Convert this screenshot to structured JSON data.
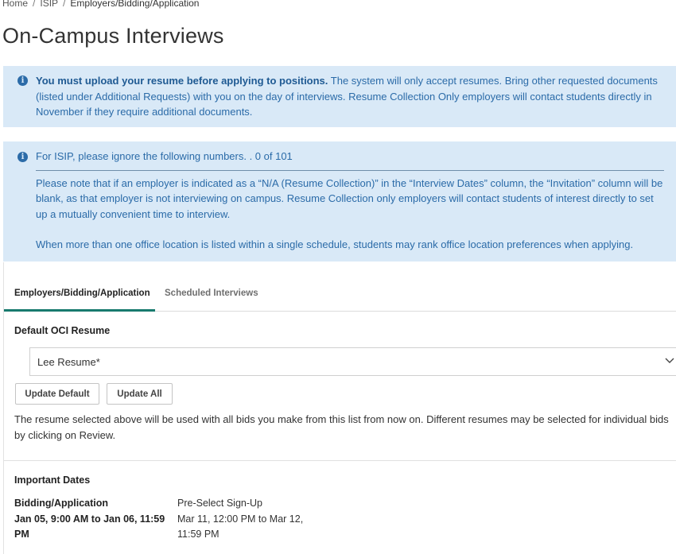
{
  "breadcrumb": {
    "items": [
      "Home",
      "ISIP"
    ],
    "current": "Employers/Bidding/Application",
    "separator": "/"
  },
  "page_title": "On-Campus Interviews",
  "alert1": {
    "bold": "You must upload your resume before applying to positions.",
    "text": " The system will only accept resumes. Bring other requested documents (listed under Additional Requests) with you on the day of interviews. Resume Collection Only employers will contact students directly in November if they require additional documents."
  },
  "alert2": {
    "header": "For ISIP, please ignore the following numbers. . 0 of 101",
    "para1": "Please note that if an employer is indicated as a “N/A (Resume Collection)” in the “Interview Dates” column, the “Invitation” column will be blank, as that employer is not interviewing on campus. Resume Collection only employers will contact students of interest directly to set up a mutually convenient time to interview.",
    "para2": "When more than one office location is listed within a single schedule, students may rank office location preferences when applying."
  },
  "tabs": [
    {
      "label": "Employers/Bidding/Application",
      "active": true
    },
    {
      "label": "Scheduled Interviews",
      "active": false
    }
  ],
  "resume": {
    "label": "Default OCI Resume",
    "selected": "Lee Resume*",
    "update_default_label": "Update Default",
    "update_all_label": "Update All",
    "help": "The resume selected above will be used with all bids you make from this list from now on. Different resumes may be selected for individual bids by clicking on Review."
  },
  "important_dates": {
    "label": "Important Dates",
    "items": [
      {
        "name": "Bidding/Application",
        "range": "Jan 05, 9:00 AM to Jan 06, 11:59 PM"
      },
      {
        "name": "Pre-Select Sign-Up",
        "range": "Mar 11, 12:00 PM to Mar 12, 11:59 PM"
      }
    ]
  },
  "colors": {
    "alert_bg": "#d9e9f7",
    "alert_text": "#2b6ba8",
    "tab_accent": "#187a6e"
  },
  "icons": {
    "info": "info-circle-icon",
    "select": "chevron-down-icon"
  }
}
